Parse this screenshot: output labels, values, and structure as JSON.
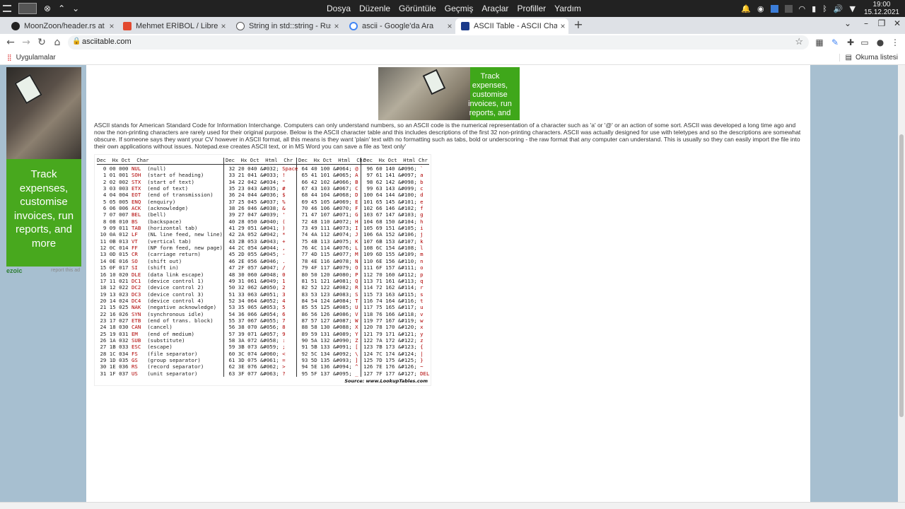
{
  "system": {
    "menus": [
      "Dosya",
      "Düzenle",
      "Görüntüle",
      "Geçmiş",
      "Araçlar",
      "Profiller",
      "Yardım"
    ],
    "time": "19:00",
    "date": "15.12.2021"
  },
  "tabs": [
    {
      "title": "MoonZoon/header.rs at main",
      "color": "#222"
    },
    {
      "title": "Mehmet ERİBOL / Libredu Be",
      "color": "#e2492f"
    },
    {
      "title": "String in std::string - Rust",
      "color": "#555"
    },
    {
      "title": "ascii - Google'da Ara",
      "color": "#4285f4"
    },
    {
      "title": "ASCII Table - ASCII Character",
      "color": "#1a3a8a"
    }
  ],
  "address": {
    "url": "asciitable.com"
  },
  "bookmarks": {
    "apps_label": "Uygulamalar",
    "reading_list": "Okuma listesi"
  },
  "ads": {
    "left_text": "Track expenses, customise invoices, run reports, and more",
    "top_text": "Track expenses, customise invoices, run reports, and more",
    "ezoic": "ezoic",
    "report": "report this ad"
  },
  "intro": "ASCII stands for American Standard Code for Information Interchange. Computers can only understand numbers, so an ASCII code is the numerical representation of a character such as 'a' or '@' or an action of some sort. ASCII was developed a long time ago and now the non-printing characters are rarely used for their original purpose. Below is the ASCII character table and this includes descriptions of the first 32 non-printing characters. ASCII was actually designed for use with teletypes and so the descriptions are somewhat obscure. If someone says they want your CV however in ASCII format, all this means is they want 'plain' text with no formatting such as tabs, bold or underscoring - the raw format that any computer can understand. This is usually so they can easily import the file into their own applications without issues. Notepad.exe creates ASCII text, or in MS Word you can save a file as 'text only'",
  "ascii_table": {
    "headers": {
      "c1": "Dec  Hx Oct  Char",
      "c2": "Dec  Hx Oct  Html  Chr",
      "c3": "Dec  Hx Oct  Html  Chr",
      "c4": "Dec  Hx Oct  Html Chr"
    },
    "control_names": [
      "NUL",
      "SOH",
      "STX",
      "ETX",
      "EOT",
      "ENQ",
      "ACK",
      "BEL",
      "BS",
      "TAB",
      "LF",
      "VT",
      "FF",
      "CR",
      "SO",
      "SI",
      "DLE",
      "DC1",
      "DC2",
      "DC3",
      "DC4",
      "NAK",
      "SYN",
      "ETB",
      "CAN",
      "EM",
      "SUB",
      "ESC",
      "FS",
      "GS",
      "RS",
      "US"
    ],
    "control_desc": [
      "(null)",
      "(start of heading)",
      "(start of text)",
      "(end of text)",
      "(end of transmission)",
      "(enquiry)",
      "(acknowledge)",
      "(bell)",
      "(backspace)",
      "(horizontal tab)",
      "(NL line feed, new line)",
      "(vertical tab)",
      "(NP form feed, new page)",
      "(carriage return)",
      "(shift out)",
      "(shift in)",
      "(data link escape)",
      "(device control 1)",
      "(device control 2)",
      "(device control 3)",
      "(device control 4)",
      "(negative acknowledge)",
      "(synchronous idle)",
      "(end of trans. block)",
      "(cancel)",
      "(end of medium)",
      "(substitute)",
      "(escape)",
      "(file separator)",
      "(group separator)",
      "(record separator)",
      "(unit separator)"
    ],
    "source": "Source:  www.LookupTables.com"
  }
}
